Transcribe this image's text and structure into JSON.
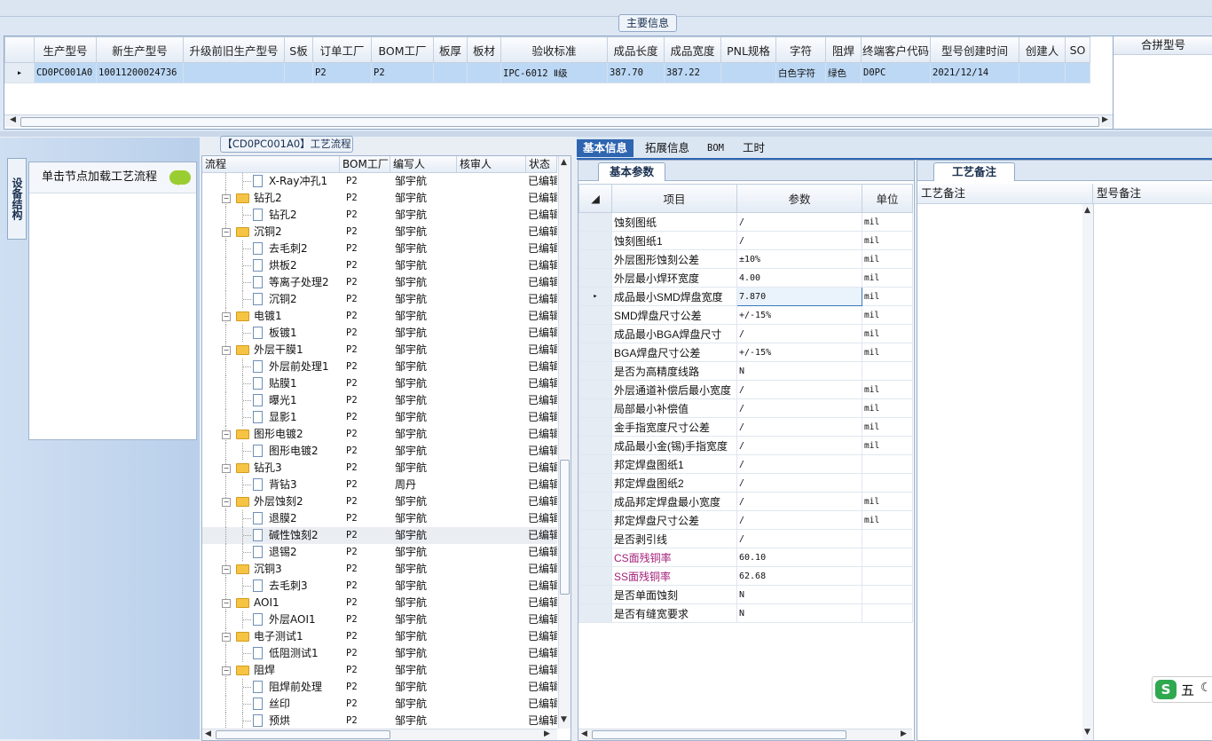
{
  "main_info": {
    "title": "主要信息",
    "columns": [
      "生产型号",
      "新生产型号",
      "升级前旧生产型号",
      "S板",
      "订单工厂",
      "BOM工厂",
      "板厚",
      "板材",
      "验收标准",
      "成品长度",
      "成品宽度",
      "PNL规格",
      "字符",
      "阻焊",
      "终端客户代码",
      "型号创建时间",
      "创建人",
      "SO"
    ],
    "row": [
      "CD0PC001A0",
      "10011200024736",
      "",
      "",
      "P2",
      "P2",
      "",
      "",
      "IPC-6012 Ⅱ级",
      "387.70",
      "387.22",
      "",
      "白色字符",
      "绿色",
      "D0PC",
      "2021/12/14",
      "",
      ""
    ],
    "merge_header": "合拼型号"
  },
  "left_panel": {
    "vertical_tab": "设备结构",
    "load_hint": "单击节点加载工艺流程",
    "bubble_icon": "speech-bubble-icon"
  },
  "tree": {
    "title": "【CD0PC001A0】工艺流程",
    "headers": [
      "流程",
      "BOM工厂",
      "编写人",
      "核审人",
      "状态"
    ],
    "rows": [
      {
        "level": 1,
        "type": "file",
        "name": "X-Ray冲孔1",
        "bom": "P2",
        "writer": "邹宇航",
        "reviewer": "",
        "status": "已编辑"
      },
      {
        "level": 0,
        "type": "folder",
        "name": "钻孔2",
        "bom": "P2",
        "writer": "邹宇航",
        "reviewer": "",
        "status": "已编辑"
      },
      {
        "level": 1,
        "type": "file",
        "name": "钻孔2",
        "bom": "P2",
        "writer": "邹宇航",
        "reviewer": "",
        "status": "已编辑"
      },
      {
        "level": 0,
        "type": "folder",
        "name": "沉铜2",
        "bom": "P2",
        "writer": "邹宇航",
        "reviewer": "",
        "status": "已编辑"
      },
      {
        "level": 1,
        "type": "file",
        "name": "去毛刺2",
        "bom": "P2",
        "writer": "邹宇航",
        "reviewer": "",
        "status": "已编辑"
      },
      {
        "level": 1,
        "type": "file",
        "name": "烘板2",
        "bom": "P2",
        "writer": "邹宇航",
        "reviewer": "",
        "status": "已编辑"
      },
      {
        "level": 1,
        "type": "file",
        "name": "等离子处理2",
        "bom": "P2",
        "writer": "邹宇航",
        "reviewer": "",
        "status": "已编辑"
      },
      {
        "level": 1,
        "type": "file",
        "name": "沉铜2",
        "bom": "P2",
        "writer": "邹宇航",
        "reviewer": "",
        "status": "已编辑"
      },
      {
        "level": 0,
        "type": "folder",
        "name": "电镀1",
        "bom": "P2",
        "writer": "邹宇航",
        "reviewer": "",
        "status": "已编辑"
      },
      {
        "level": 1,
        "type": "file",
        "name": "板镀1",
        "bom": "P2",
        "writer": "邹宇航",
        "reviewer": "",
        "status": "已编辑"
      },
      {
        "level": 0,
        "type": "folder",
        "name": "外层干膜1",
        "bom": "P2",
        "writer": "邹宇航",
        "reviewer": "",
        "status": "已编辑"
      },
      {
        "level": 1,
        "type": "file",
        "name": "外层前处理1",
        "bom": "P2",
        "writer": "邹宇航",
        "reviewer": "",
        "status": "已编辑"
      },
      {
        "level": 1,
        "type": "file",
        "name": "贴膜1",
        "bom": "P2",
        "writer": "邹宇航",
        "reviewer": "",
        "status": "已编辑"
      },
      {
        "level": 1,
        "type": "file",
        "name": "曝光1",
        "bom": "P2",
        "writer": "邹宇航",
        "reviewer": "",
        "status": "已编辑"
      },
      {
        "level": 1,
        "type": "file",
        "name": "显影1",
        "bom": "P2",
        "writer": "邹宇航",
        "reviewer": "",
        "status": "已编辑"
      },
      {
        "level": 0,
        "type": "folder",
        "name": "图形电镀2",
        "bom": "P2",
        "writer": "邹宇航",
        "reviewer": "",
        "status": "已编辑"
      },
      {
        "level": 1,
        "type": "file",
        "name": "图形电镀2",
        "bom": "P2",
        "writer": "邹宇航",
        "reviewer": "",
        "status": "已编辑"
      },
      {
        "level": 0,
        "type": "folder",
        "name": "钻孔3",
        "bom": "P2",
        "writer": "邹宇航",
        "reviewer": "",
        "status": "已编辑"
      },
      {
        "level": 1,
        "type": "file",
        "name": "背钻3",
        "bom": "P2",
        "writer": "周丹",
        "reviewer": "",
        "status": "已编辑"
      },
      {
        "level": 0,
        "type": "folder",
        "name": "外层蚀刻2",
        "bom": "P2",
        "writer": "邹宇航",
        "reviewer": "",
        "status": "已编辑"
      },
      {
        "level": 1,
        "type": "file",
        "name": "退膜2",
        "bom": "P2",
        "writer": "邹宇航",
        "reviewer": "",
        "status": "已编辑"
      },
      {
        "level": 1,
        "type": "file",
        "name": "碱性蚀刻2",
        "bom": "P2",
        "writer": "邹宇航",
        "reviewer": "",
        "status": "已编辑",
        "selected": true
      },
      {
        "level": 1,
        "type": "file",
        "name": "退锡2",
        "bom": "P2",
        "writer": "邹宇航",
        "reviewer": "",
        "status": "已编辑"
      },
      {
        "level": 0,
        "type": "folder",
        "name": "沉铜3",
        "bom": "P2",
        "writer": "邹宇航",
        "reviewer": "",
        "status": "已编辑"
      },
      {
        "level": 1,
        "type": "file",
        "name": "去毛刺3",
        "bom": "P2",
        "writer": "邹宇航",
        "reviewer": "",
        "status": "已编辑"
      },
      {
        "level": 0,
        "type": "folder",
        "name": "AOI1",
        "bom": "P2",
        "writer": "邹宇航",
        "reviewer": "",
        "status": "已编辑"
      },
      {
        "level": 1,
        "type": "file",
        "name": "外层AOI1",
        "bom": "P2",
        "writer": "邹宇航",
        "reviewer": "",
        "status": "已编辑"
      },
      {
        "level": 0,
        "type": "folder",
        "name": "电子测试1",
        "bom": "P2",
        "writer": "邹宇航",
        "reviewer": "",
        "status": "已编辑"
      },
      {
        "level": 1,
        "type": "file",
        "name": "低阻测试1",
        "bom": "P2",
        "writer": "邹宇航",
        "reviewer": "",
        "status": "已编辑"
      },
      {
        "level": 0,
        "type": "folder",
        "name": "阻焊",
        "bom": "P2",
        "writer": "邹宇航",
        "reviewer": "",
        "status": "已编辑"
      },
      {
        "level": 1,
        "type": "file",
        "name": "阻焊前处理",
        "bom": "P2",
        "writer": "邹宇航",
        "reviewer": "",
        "status": "已编辑"
      },
      {
        "level": 1,
        "type": "file",
        "name": "丝印",
        "bom": "P2",
        "writer": "邹宇航",
        "reviewer": "",
        "status": "已编辑"
      },
      {
        "level": 1,
        "type": "file",
        "name": "预烘",
        "bom": "P2",
        "writer": "邹宇航",
        "reviewer": "",
        "status": "已编辑"
      }
    ]
  },
  "tabs": [
    "基本信息",
    "拓展信息",
    "BOM",
    "工时"
  ],
  "base_params": {
    "subtab": "基本参数",
    "headers": [
      "项目",
      "参数",
      "单位"
    ],
    "rows": [
      {
        "item": "蚀刻图纸",
        "value": "/",
        "unit": "mil"
      },
      {
        "item": "蚀刻图纸1",
        "value": "/",
        "unit": "mil"
      },
      {
        "item": "外层图形蚀刻公差",
        "value": "±10%",
        "unit": "mil"
      },
      {
        "item": "外层最小焊环宽度",
        "value": "4.00",
        "unit": "mil"
      },
      {
        "item": "成品最小SMD焊盘宽度",
        "value": "7.870",
        "unit": "mil",
        "current": true
      },
      {
        "item": "SMD焊盘尺寸公差",
        "value": "+/-15%",
        "unit": "mil"
      },
      {
        "item": "成品最小BGA焊盘尺寸",
        "value": "/",
        "unit": "mil"
      },
      {
        "item": "BGA焊盘尺寸公差",
        "value": "+/-15%",
        "unit": "mil"
      },
      {
        "item": "是否为高精度线路",
        "value": "N",
        "unit": ""
      },
      {
        "item": "外层通道补偿后最小宽度",
        "value": "/",
        "unit": "mil"
      },
      {
        "item": "局部最小补偿值",
        "value": "/",
        "unit": "mil"
      },
      {
        "item": "金手指宽度尺寸公差",
        "value": "/",
        "unit": "mil"
      },
      {
        "item": "成品最小金(锡)手指宽度",
        "value": "/",
        "unit": "mil"
      },
      {
        "item": "邦定焊盘图纸1",
        "value": "/",
        "unit": ""
      },
      {
        "item": "邦定焊盘图纸2",
        "value": "/",
        "unit": ""
      },
      {
        "item": "成品邦定焊盘最小宽度",
        "value": "/",
        "unit": "mil"
      },
      {
        "item": "邦定焊盘尺寸公差",
        "value": "/",
        "unit": "mil"
      },
      {
        "item": "是否剥引线",
        "value": "/",
        "unit": ""
      },
      {
        "item": "CS面残铜率",
        "value": "60.10",
        "unit": "",
        "highlight": true
      },
      {
        "item": "SS面残铜率",
        "value": "62.68",
        "unit": "",
        "highlight": true
      },
      {
        "item": "是否单面蚀刻",
        "value": "N",
        "unit": ""
      },
      {
        "item": "是否有缝宽要求",
        "value": "N",
        "unit": ""
      }
    ]
  },
  "process_notes": {
    "subtab": "工艺备注",
    "headers": [
      "工艺备注",
      "型号备注"
    ]
  },
  "ime": {
    "label": "五",
    "icon": "S"
  }
}
